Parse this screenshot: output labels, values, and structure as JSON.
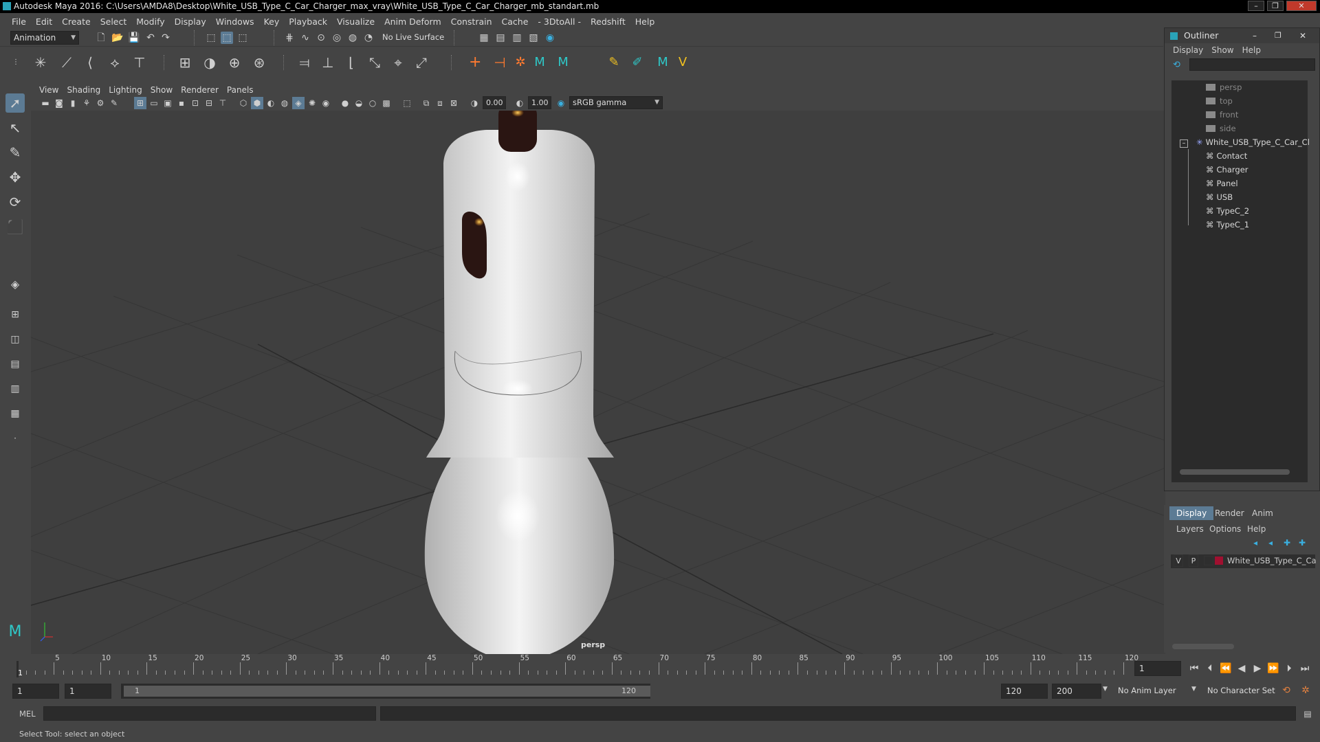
{
  "window": {
    "title": "Autodesk Maya 2016: C:\\Users\\AMDA8\\Desktop\\White_USB_Type_C_Car_Charger_max_vray\\White_USB_Type_C_Car_Charger_mb_standart.mb"
  },
  "menubar": [
    "File",
    "Edit",
    "Create",
    "Select",
    "Modify",
    "Display",
    "Windows",
    "Key",
    "Playback",
    "Visualize",
    "Anim Deform",
    "Constrain",
    "Cache",
    "- 3DtoAll -",
    "Redshift",
    "Help"
  ],
  "statusline": {
    "menu_set": "Animation",
    "live_surface": "No Live Surface"
  },
  "viewport_menu": [
    "View",
    "Shading",
    "Lighting",
    "Show",
    "Renderer",
    "Panels"
  ],
  "viewport_toolbar": {
    "exposure": "0.00",
    "gamma": "1.00",
    "color_space": "sRGB gamma"
  },
  "viewport": {
    "camera_label": "persp",
    "colors": {
      "grid_line": "#353535",
      "axis_line": "#262626",
      "background": "#3f3f3f",
      "model_white": "#e8e8e8",
      "model_dark": "#2a1512"
    }
  },
  "outliner": {
    "title": "Outliner",
    "menu": [
      "Display",
      "Show",
      "Help"
    ],
    "items": [
      {
        "label": "persp",
        "dim": true
      },
      {
        "label": "top",
        "dim": true
      },
      {
        "label": "front",
        "dim": true
      },
      {
        "label": "side",
        "dim": true
      },
      {
        "label": "White_USB_Type_C_Car_Cl",
        "dim": false
      },
      {
        "label": "Contact",
        "dim": false
      },
      {
        "label": "Charger",
        "dim": false
      },
      {
        "label": "Panel",
        "dim": false
      },
      {
        "label": "USB",
        "dim": false
      },
      {
        "label": "TypeC_2",
        "dim": false
      },
      {
        "label": "TypeC_1",
        "dim": false
      }
    ]
  },
  "layers": {
    "tabs": [
      "Display",
      "Render",
      "Anim"
    ],
    "menu": [
      "Layers",
      "Options",
      "Help"
    ],
    "layer": {
      "v": "V",
      "p": "P",
      "name": "White_USB_Type_C_Ca",
      "color": "#a01030"
    }
  },
  "timeslider": {
    "ticks": [
      "5",
      "10",
      "15",
      "20",
      "25",
      "30",
      "35",
      "40",
      "45",
      "50",
      "55",
      "60",
      "65",
      "70",
      "75",
      "80",
      "85",
      "90",
      "95",
      "100",
      "105",
      "110",
      "115",
      "120"
    ],
    "current_frame_marker": "1",
    "current_frame": "1"
  },
  "rangeslider": {
    "start": "1",
    "playback_start": "1",
    "range_start_label": "1",
    "range_end_label": "120",
    "playback_end": "120",
    "end": "200",
    "anim_layer": "No Anim Layer",
    "character_set": "No Character Set"
  },
  "cmdline": {
    "label": "MEL"
  },
  "helpline": {
    "text": "Select Tool: select an object"
  }
}
